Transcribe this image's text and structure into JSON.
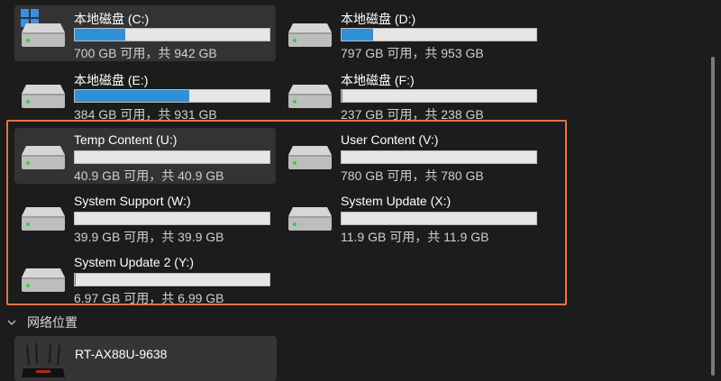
{
  "drives": [
    {
      "name": "本地磁盘 (C:)",
      "space": "700 GB 可用，共 942 GB",
      "used_fraction": 0.257,
      "system": true
    },
    {
      "name": "本地磁盘 (D:)",
      "space": "797 GB 可用，共 953 GB",
      "used_fraction": 0.164
    },
    {
      "name": "本地磁盘 (E:)",
      "space": "384 GB 可用，共 931 GB",
      "used_fraction": 0.588
    },
    {
      "name": "本地磁盘 (F:)",
      "space": "237 GB 可用，共 238 GB",
      "used_fraction": 0.004
    },
    {
      "name": "Temp Content (U:)",
      "space": "40.9 GB 可用，共 40.9 GB",
      "used_fraction": 0.0,
      "selected": true
    },
    {
      "name": "User Content (V:)",
      "space": "780 GB 可用，共 780 GB",
      "used_fraction": 0.0
    },
    {
      "name": "System Support (W:)",
      "space": "39.9 GB 可用，共 39.9 GB",
      "used_fraction": 0.0
    },
    {
      "name": "System Update (X:)",
      "space": "11.9 GB 可用，共 11.9 GB",
      "used_fraction": 0.0
    },
    {
      "name": "System Update 2 (Y:)",
      "space": "6.97 GB 可用，共 6.99 GB",
      "used_fraction": 0.003
    }
  ],
  "network_section": {
    "label": "网络位置",
    "expanded": true
  },
  "network_items": [
    {
      "name": "RT-AX88U-9638"
    }
  ],
  "colors": {
    "background": "#1c1c1c",
    "usage_fill": "#2f8fd8",
    "highlight_border": "#e8734a",
    "selected_tile": "#333333"
  },
  "icons": {
    "drive": "hard-drive-icon",
    "system": "windows-logo-icon",
    "router": "router-icon",
    "section": "chevron-down-icon"
  }
}
